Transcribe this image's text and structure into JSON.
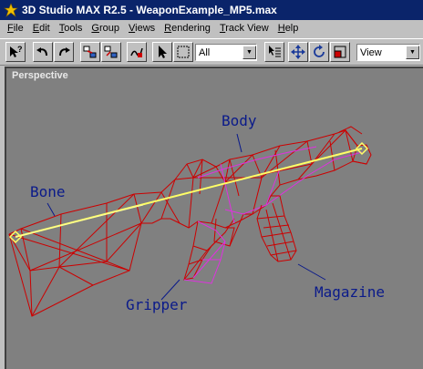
{
  "window": {
    "title": "3D Studio MAX R2.5 - WeaponExample_MP5.max",
    "app_icon": "3dsmax-logo-icon"
  },
  "menu": [
    {
      "pre": "",
      "u": "F",
      "post": "ile"
    },
    {
      "pre": "",
      "u": "E",
      "post": "dit"
    },
    {
      "pre": "",
      "u": "T",
      "post": "ools"
    },
    {
      "pre": "",
      "u": "G",
      "post": "roup"
    },
    {
      "pre": "",
      "u": "V",
      "post": "iews"
    },
    {
      "pre": "",
      "u": "R",
      "post": "endering"
    },
    {
      "pre": "",
      "u": "T",
      "post": "rack View"
    },
    {
      "pre": "",
      "u": "H",
      "post": "elp"
    }
  ],
  "toolbar": {
    "buttons": [
      "help-pointer-icon",
      "undo-icon",
      "redo-icon",
      "link-icon",
      "unlink-icon",
      "bind-space-warp-icon",
      "select-arrow-icon",
      "select-region-icon"
    ],
    "selection_filter": "All",
    "buttons2": [
      "select-by-name-icon",
      "move-icon",
      "rotate-icon",
      "scale-icon"
    ],
    "coord_system": "View"
  },
  "viewport": {
    "label": "Perspective",
    "annotations": {
      "body": "Body",
      "bone": "Bone",
      "gripper": "Gripper",
      "magazine": "Magazine"
    },
    "colors": {
      "background": "#808080",
      "mesh": "#cc0000",
      "bone": "#ffff66",
      "gripper_mesh": "#e030e0",
      "annotation_text": "#0a1a8a"
    }
  }
}
